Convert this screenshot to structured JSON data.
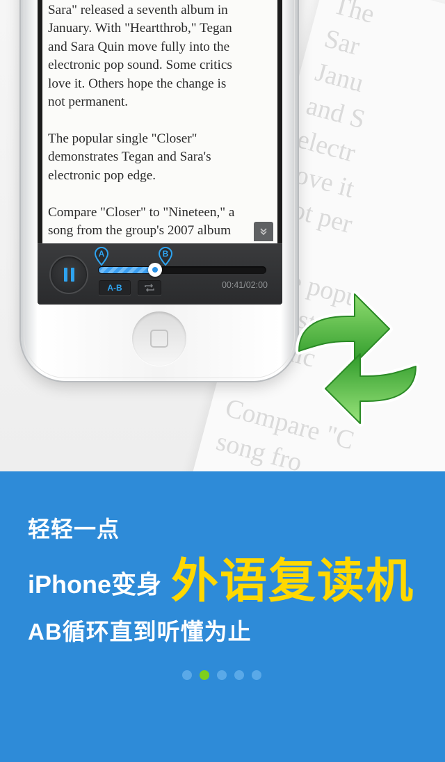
{
  "reader": {
    "paragraphs": [
      "Sara\" released a seventh album in\nJanuary. With \"Heartthrob,\" Tegan\nand Sara Quin move fully into the\nelectronic pop sound. Some critics\nlove it. Others hope the change is\nnot permanent.",
      "The popular single \"Closer\"\ndemonstrates Tegan and Sara's\nelectronic pop edge.",
      "Compare \"Closer\" to \"Nineteen,\" a\nsong from the group's 2007 album"
    ]
  },
  "player": {
    "marker_a": "A",
    "marker_b": "B",
    "progress": 0.34,
    "marker_a_pos": 0.02,
    "marker_b_pos": 0.4,
    "ab_label": "A-B",
    "time": "00:41/02:00",
    "icons": [
      "pause-icon",
      "repeat-icon",
      "collapse-icon",
      "home-icon"
    ]
  },
  "background_text": [
    "The",
    "Sar",
    "Janu",
    "and S",
    "electr",
    "love it",
    "not per",
    "The popu",
    "monstra",
    "ctronic",
    "Compare \"C",
    "song fro"
  ],
  "banner": {
    "line1": "轻轻一点",
    "line2_prefix": "iPhone变身",
    "line2_highlight": "外语复读机",
    "line3": "AB循环直到听懂为止"
  },
  "pager": {
    "count": 5,
    "active": 1
  },
  "colors": {
    "banner": "#2e8bd8",
    "highlight": "#ffd800",
    "accent": "#2ea3ef",
    "dot_active": "#7fcf1d",
    "dot": "#5aa9e8"
  }
}
